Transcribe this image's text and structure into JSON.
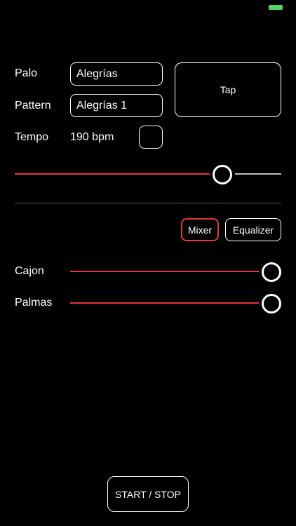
{
  "status_bar": {
    "battery_color": "#4cd964"
  },
  "form": {
    "palo_label": "Palo",
    "palo_value": "Alegrías",
    "pattern_label": "Pattern",
    "pattern_value": "Alegrías 1",
    "tempo_label": "Tempo",
    "tempo_value": "190 bpm"
  },
  "tap_label": "Tap",
  "tempo_slider": {
    "fraction": 0.78
  },
  "tabs": {
    "mixer_label": "Mixer",
    "equalizer_label": "Equalizer",
    "selected": "Mixer"
  },
  "mixer": {
    "tracks": [
      {
        "label": "Cajon",
        "fraction": 1.0
      },
      {
        "label": "Palmas",
        "fraction": 1.0
      }
    ]
  },
  "start_stop_label": "START / STOP",
  "accent_color": "#e53935"
}
